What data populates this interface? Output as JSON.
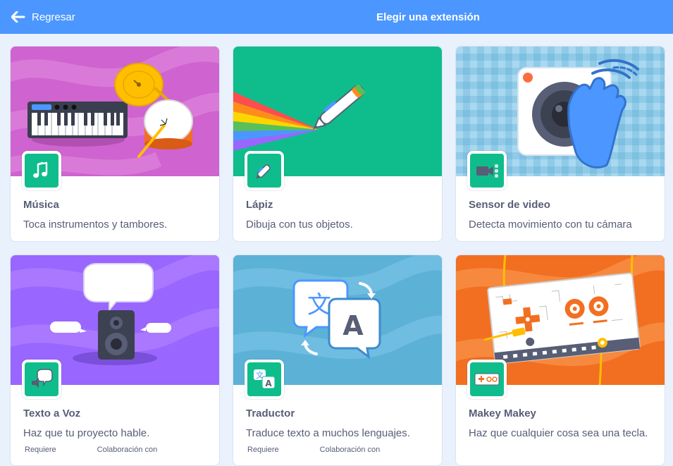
{
  "header": {
    "back_label": "Regresar",
    "title": "Elegir una extensión"
  },
  "colors": {
    "header_bg": "#4c97ff",
    "badge_green": "#0fbd8c",
    "text": "#575e75"
  },
  "extensions": [
    {
      "name": "Música",
      "description": "Toca instrumentos y tambores.",
      "icon": "music-notes-icon"
    },
    {
      "name": "Lápiz",
      "description": "Dibuja con tus objetos.",
      "icon": "pen-icon"
    },
    {
      "name": "Sensor de video",
      "description": "Detecta movimiento con tu cámara",
      "icon": "video-camera-icon"
    },
    {
      "name": "Texto a Voz",
      "description": "Haz que tu proyecto hable.",
      "icon": "speech-bubble-icon",
      "requirement_label": "Requiere",
      "collaboration_label": "Colaboración con"
    },
    {
      "name": "Traductor",
      "description": "Traduce texto a muchos lenguajes.",
      "icon": "translate-icon",
      "requirement_label": "Requiere",
      "collaboration_label": "Colaboración con"
    },
    {
      "name": "Makey Makey",
      "description": "Haz que cualquier cosa sea una tecla.",
      "icon": "makey-board-icon"
    }
  ]
}
